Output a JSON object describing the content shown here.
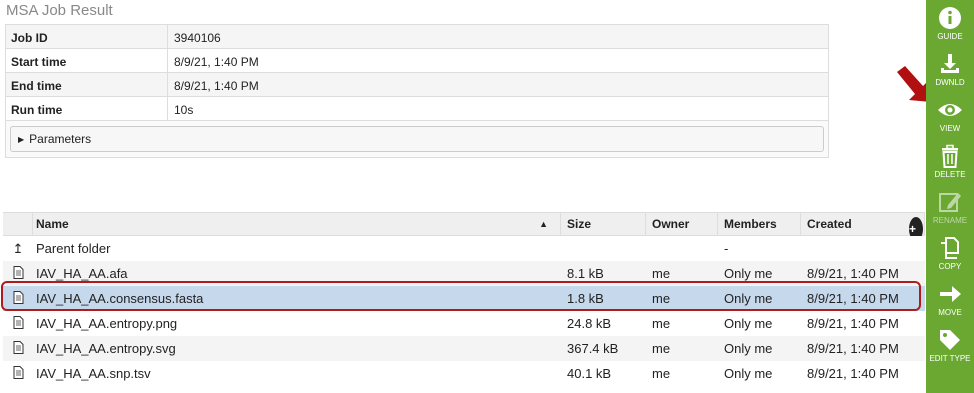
{
  "page_title": "MSA Job Result",
  "info": {
    "rows": [
      {
        "key": "Job ID",
        "value": "3940106"
      },
      {
        "key": "Start time",
        "value": "8/9/21, 1:40 PM"
      },
      {
        "key": "End time",
        "value": "8/9/21, 1:40 PM"
      },
      {
        "key": "Run time",
        "value": "10s"
      }
    ],
    "parameters_label": "Parameters"
  },
  "files": {
    "columns": {
      "name": "Name",
      "size": "Size",
      "owner": "Owner",
      "members": "Members",
      "created": "Created"
    },
    "parent_folder": {
      "name": "Parent folder",
      "members": "-"
    },
    "rows": [
      {
        "name": "IAV_HA_AA.afa",
        "size": "8.1 kB",
        "owner": "me",
        "members": "Only me",
        "created": "8/9/21, 1:40 PM"
      },
      {
        "name": "IAV_HA_AA.consensus.fasta",
        "size": "1.8 kB",
        "owner": "me",
        "members": "Only me",
        "created": "8/9/21, 1:40 PM"
      },
      {
        "name": "IAV_HA_AA.entropy.png",
        "size": "24.8 kB",
        "owner": "me",
        "members": "Only me",
        "created": "8/9/21, 1:40 PM"
      },
      {
        "name": "IAV_HA_AA.entropy.svg",
        "size": "367.4 kB",
        "owner": "me",
        "members": "Only me",
        "created": "8/9/21, 1:40 PM"
      },
      {
        "name": "IAV_HA_AA.snp.tsv",
        "size": "40.1 kB",
        "owner": "me",
        "members": "Only me",
        "created": "8/9/21, 1:40 PM"
      }
    ]
  },
  "sidebar": {
    "guide": "GUIDE",
    "download": "DWNLD",
    "view": "VIEW",
    "delete": "DELETE",
    "rename": "RENAME",
    "copy": "COPY",
    "move": "MOVE",
    "edit_type": "EDIT TYPE"
  },
  "colors": {
    "sidebar_bg": "#6aa832",
    "selected_row": "#c6d9ec",
    "highlight_border": "#b01c1c"
  }
}
